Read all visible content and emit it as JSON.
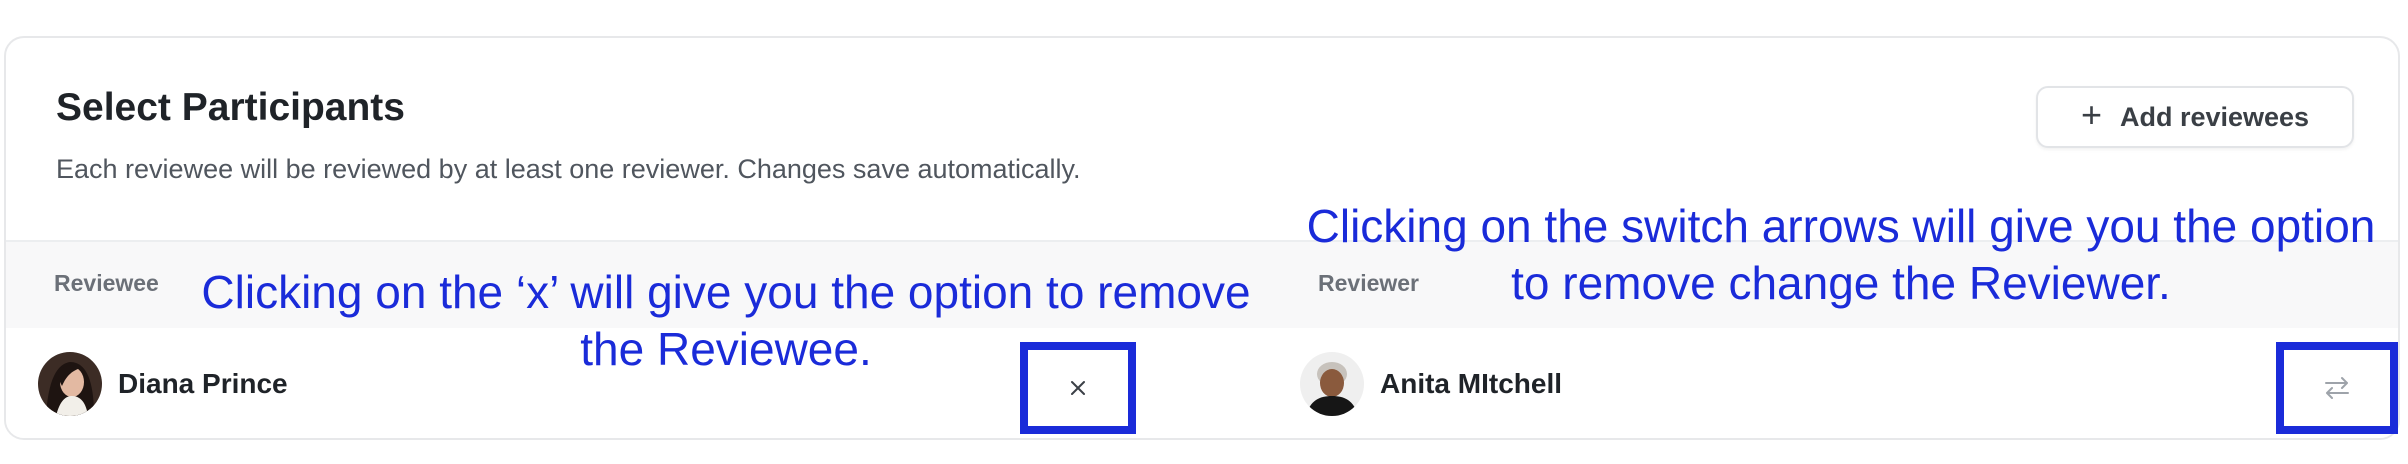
{
  "header": {
    "title": "Select Participants",
    "subtitle": "Each reviewee will be reviewed by at least one reviewer. Changes save automatically.",
    "add_button_label": "Add reviewees",
    "add_button_icon": "plus-icon"
  },
  "table": {
    "columns": [
      "Reviewee",
      "Reviewer"
    ],
    "rows": [
      {
        "reviewee": "Diana Prince",
        "reviewer": "Anita MItchell",
        "remove_icon": "close-icon",
        "switch_icon": "swap-arrows-icon"
      }
    ]
  },
  "annotations": {
    "remove_line1": "Clicking on the ‘x’ will give you the option to remove",
    "remove_line2": "the Reviewee.",
    "switch_line1": "Clicking on the switch arrows will give you the option",
    "switch_line2": "to remove change the Reviewer.",
    "highlight_color": "#1a2bd9"
  }
}
